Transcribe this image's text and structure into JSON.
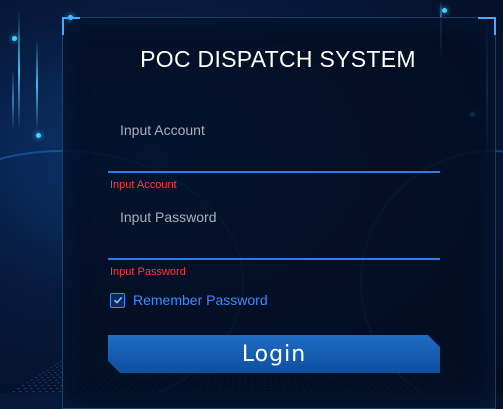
{
  "login_form": {
    "title": "POC DISPATCH SYSTEM",
    "account": {
      "placeholder": "Input Account",
      "value": "",
      "error": "Input Account"
    },
    "password": {
      "placeholder": "Input Password",
      "value": "",
      "error": "Input Password"
    },
    "remember": {
      "label": "Remember Password",
      "checked": true
    },
    "login_label": "Login"
  },
  "colors": {
    "accent": "#2b7fe0",
    "error": "#ff3b3b",
    "link": "#3a8cff",
    "button": "#1f6cc4"
  },
  "icons": {
    "remember_check": "checkmark-icon"
  }
}
